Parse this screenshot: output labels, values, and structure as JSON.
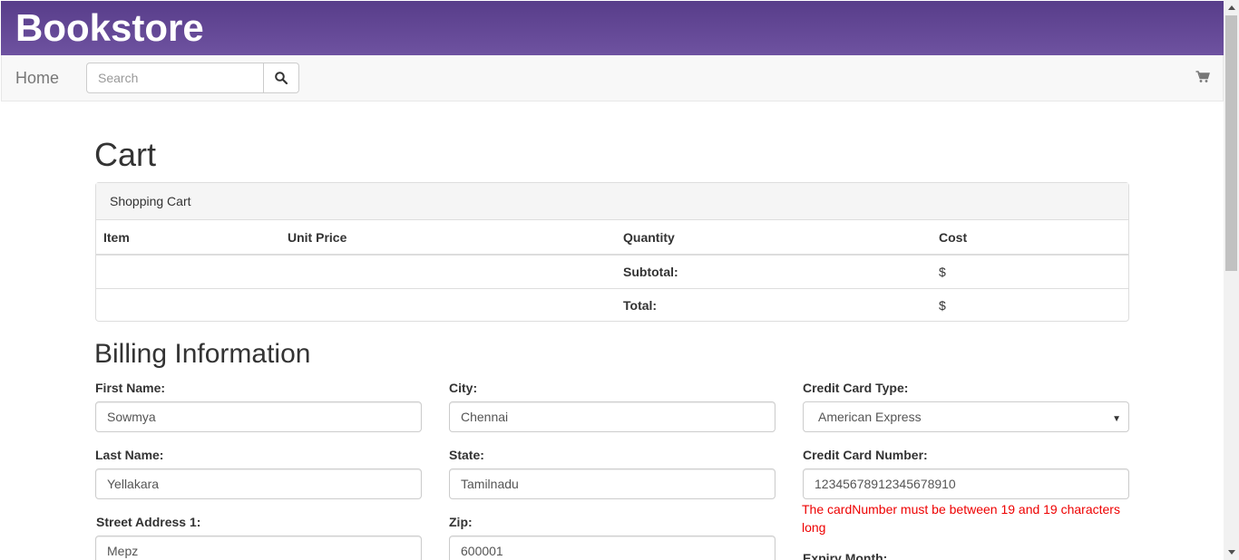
{
  "header": {
    "brand": "Bookstore"
  },
  "nav": {
    "home_label": "Home",
    "search_placeholder": "Search",
    "search_icon": "search-icon",
    "cart_icon": "shopping-cart-icon"
  },
  "cart": {
    "title": "Cart",
    "panel_heading": "Shopping Cart",
    "columns": [
      "Item",
      "Unit Price",
      "Quantity",
      "Cost"
    ],
    "subtotal_label": "Subtotal:",
    "subtotal_value": "$",
    "total_label": "Total:",
    "total_value": "$"
  },
  "billing": {
    "title": "Billing Information",
    "first_name": {
      "label": "First Name:",
      "value": "Sowmya"
    },
    "last_name": {
      "label": "Last Name:",
      "value": "Yellakara"
    },
    "street1": {
      "label": "Street Address 1:",
      "value": "Mepz"
    },
    "city": {
      "label": "City:",
      "value": "Chennai"
    },
    "state": {
      "label": "State:",
      "value": "Tamilnadu"
    },
    "zip": {
      "label": "Zip:",
      "value": "600001"
    },
    "card_type": {
      "label": "Credit Card Type:",
      "value": "American Express"
    },
    "card_number": {
      "label": "Credit Card Number:",
      "value": "12345678912345678910",
      "error": "The cardNumber must be between 19 and 19 characters long"
    },
    "expiry_month": {
      "label": "Expiry Month:"
    }
  },
  "colors": {
    "brand_bar": "#5e4390",
    "error": "#ee0000"
  }
}
